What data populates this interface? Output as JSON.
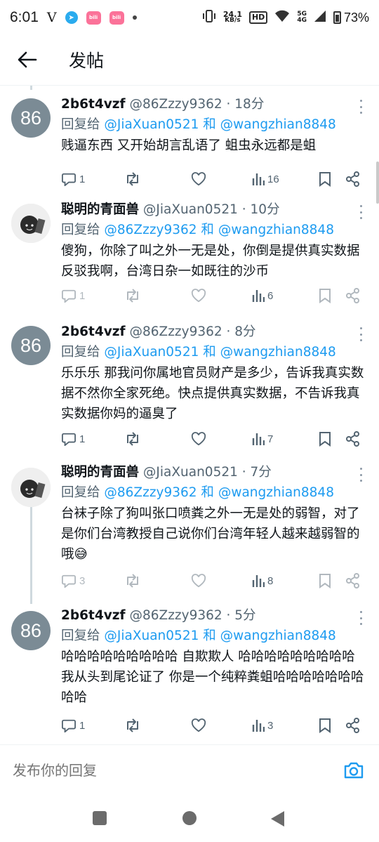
{
  "status_bar": {
    "time": "6:01",
    "carrier_icon": "V",
    "net_speed_value": "24.1",
    "net_speed_unit": "KB/s",
    "sim_label": "HD",
    "signal_top": "5G",
    "signal_bottom": "4G",
    "battery": "73%"
  },
  "header": {
    "title": "发帖"
  },
  "posts": [
    {
      "name": "2b6t4vzf",
      "handle": "@86Zzzy9362 · 18分",
      "avatar_text": "86",
      "reply_prefix": "回复给 ",
      "reply_targets": "@JiaXuan0521 和 @wangzhian8848",
      "text": "贱逼东西 又开始胡言乱语了 蛆虫永远都是蛆",
      "replies": "1",
      "views": "16"
    },
    {
      "name": "聪明的青面兽",
      "handle": "@JiaXuan0521 · 10分",
      "avatar_text": "",
      "reply_prefix": "回复给 ",
      "reply_targets": "@86Zzzy9362 和 @wangzhian8848",
      "text": "傻狗，你除了叫之外一无是处，你倒是提供真实数据反驳我啊，台湾日杂一如既往的沙币",
      "replies": "1",
      "views": "6"
    },
    {
      "name": "2b6t4vzf",
      "handle": "@86Zzzy9362 · 8分",
      "avatar_text": "86",
      "reply_prefix": "回复给 ",
      "reply_targets": "@JiaXuan0521 和 @wangzhian8848",
      "text": "乐乐乐 那我问你属地官员财产是多少，告诉我真实数据不然你全家死绝。快点提供真实数据，不告诉我真实数据你妈的逼臭了",
      "replies": "1",
      "views": "7"
    },
    {
      "name": "聪明的青面兽",
      "handle": "@JiaXuan0521 · 7分",
      "avatar_text": "",
      "reply_prefix": "回复给 ",
      "reply_targets": "@86Zzzy9362 和 @wangzhian8848",
      "text": "台袜子除了狗叫张口喷粪之外一无是处的弱智，对了是你们台湾教授自己说你们台湾年轻人越来越弱智的哦😅",
      "replies": "3",
      "views": "8"
    },
    {
      "name": "2b6t4vzf",
      "handle": "@86Zzzy9362 · 5分",
      "avatar_text": "86",
      "reply_prefix": "回复给 ",
      "reply_targets": "@JiaXuan0521 和 @wangzhian8848",
      "text": "哈哈哈哈哈哈哈哈哈 自欺欺人 哈哈哈哈哈哈哈哈哈 我从头到尾论证了 你是一个纯粹粪蛆哈哈哈哈哈哈哈哈哈",
      "replies": "1",
      "views": "3"
    }
  ],
  "composer": {
    "placeholder": "发布你的回复"
  },
  "colors": {
    "accent": "#1d9bf0",
    "secondary_text": "#536471",
    "avatar_gray": "#7b8b95"
  }
}
